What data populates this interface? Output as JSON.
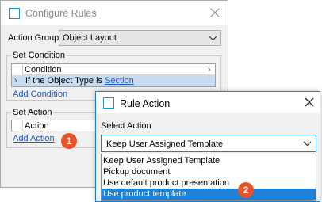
{
  "configure_rules": {
    "title": "Configure Rules",
    "action_group": {
      "label": "Action Group",
      "value": "Object Layout"
    },
    "set_condition": {
      "legend": "Set Condition",
      "table_header": "Condition",
      "row_prefix": "If the Object Type is",
      "row_link": "Section",
      "add_link": "Add Condition"
    },
    "set_action": {
      "legend": "Set Action",
      "table_header": "Action",
      "add_link": "Add Action"
    }
  },
  "rule_action": {
    "title": "Rule Action",
    "select_label": "Select Action",
    "current_value": "Keep User Assigned Template",
    "options": [
      {
        "label": "Keep User Assigned Template",
        "selected": false
      },
      {
        "label": "Pickup document",
        "selected": false
      },
      {
        "label": "Use default product presentation",
        "selected": false
      },
      {
        "label": "Use product template",
        "selected": true
      }
    ]
  },
  "callouts": {
    "first": "1",
    "second": "2"
  },
  "colors": {
    "accent": "#1a7fd1",
    "link": "#1a56c4",
    "selection": "#1e80d6",
    "row_highlight": "#c7dbf1",
    "badge": "#e8522a"
  }
}
